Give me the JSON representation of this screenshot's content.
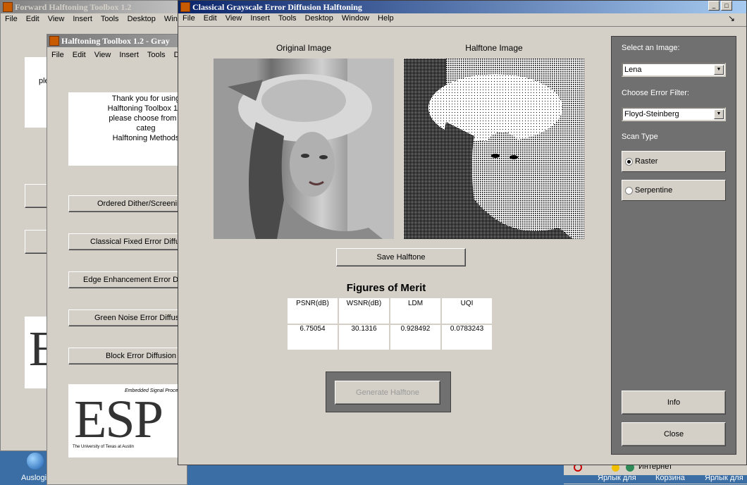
{
  "windows": {
    "back": {
      "title": "Forward Halftoning Toolbox 1.2",
      "menu": [
        "File",
        "Edit",
        "View",
        "Insert",
        "Tools",
        "Desktop",
        "Win"
      ],
      "text_snippet": "ple"
    },
    "mid": {
      "title": "Halftoning Toolbox 1.2 - Gray",
      "menu": [
        "File",
        "Edit",
        "View",
        "Insert",
        "Tools",
        "D"
      ],
      "welcome_lines": [
        "Thank you for using",
        "Halftoning Toolbox 1.2",
        "please choose from a categ",
        "Halftoning Methods"
      ],
      "buttons": [
        "Ordered Dither/Screenin",
        "Classical Fixed Error Diffu",
        "Edge Enhancement Error Di",
        "Green Noise Error Diffus",
        "Block Error Diffusion"
      ],
      "logo_text": "ESP",
      "logo_tag": "Embedded Signal Proce",
      "logo_univ": "The University of Texas at Austin"
    },
    "front": {
      "title": "Classical Grayscale Error Diffusion Halftoning",
      "menu": [
        "File",
        "Edit",
        "View",
        "Insert",
        "Tools",
        "Desktop",
        "Window",
        "Help"
      ],
      "original_label": "Original Image",
      "halftone_label": "Halftone Image",
      "save_button": "Save Halftone",
      "figures_title": "Figures of Merit",
      "metrics": {
        "headers": [
          "PSNR(dB)",
          "WSNR(dB)",
          "LDM",
          "UQI"
        ],
        "values": [
          "6.75054",
          "30.1316",
          "0.928492",
          "0.0783243"
        ]
      },
      "generate_button": "Generate Halftone",
      "panel": {
        "select_image_label": "Select an Image:",
        "select_image_value": "Lena",
        "error_filter_label": "Choose Error Filter:",
        "error_filter_value": "Floyd-Steinberg",
        "scan_type_label": "Scan Type",
        "scan_options": [
          "Raster",
          "Serpentine"
        ],
        "scan_selected": 0,
        "info_button": "Info",
        "close_button": "Close"
      }
    }
  },
  "taskbar": {
    "internet": "Интернет",
    "items": [
      "Ярлык для",
      "Корзина",
      "Ярлык для"
    ],
    "desktop_icon": "Auslogi"
  }
}
